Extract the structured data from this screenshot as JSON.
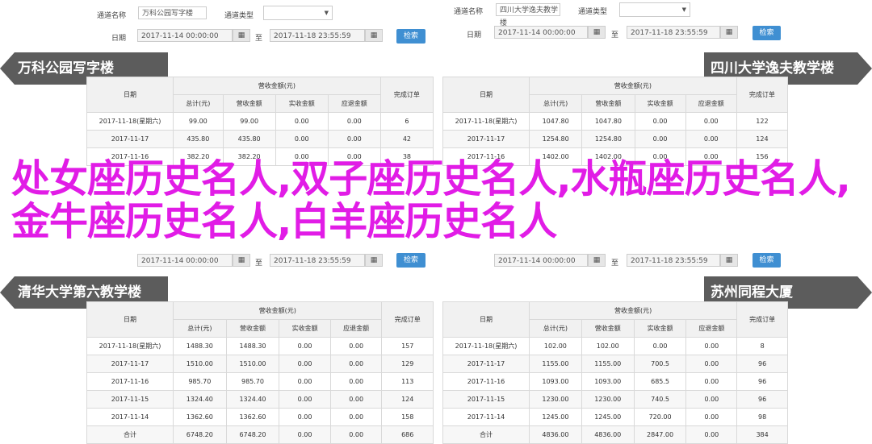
{
  "forms": [
    {
      "id": "tl",
      "school_label": "通道名称",
      "school_value": "万科公园写字楼",
      "type_label": "通道类型",
      "type_value": "",
      "date_label": "日期",
      "date_from": "2017-11-14 00:00:00",
      "sep": "至",
      "date_to": "2017-11-18 23:55:59",
      "query": "检索"
    },
    {
      "id": "tr",
      "school_label": "通道名称",
      "school_value": "四川大学逸夫教学楼",
      "type_label": "通道类型",
      "type_value": "",
      "date_label": "日期",
      "date_from": "2017-11-14 00:00:00",
      "sep": "至",
      "date_to": "2017-11-18 23:55:59",
      "query": "检索"
    },
    {
      "id": "ml",
      "date_from": "2017-11-14 00:00:00",
      "sep": "至",
      "date_to": "2017-11-18 23:55:59",
      "query": "检索"
    },
    {
      "id": "mr",
      "date_from": "2017-11-14 00:00:00",
      "sep": "至",
      "date_to": "2017-11-18 23:55:59",
      "query": "检索"
    }
  ],
  "banners": {
    "tl": "万科公园写字楼",
    "tr": "四川大学逸夫教学楼",
    "bl": "清华大学第六教学楼",
    "br": "苏州同程大厦"
  },
  "table_headers": {
    "date": "日期",
    "revenue": "营收金额(元)",
    "total": "总计(元)",
    "cash_receipt": "营收金额",
    "actual_received": "实收金额",
    "refund": "应退金额",
    "orders": "完成订单"
  },
  "tables": {
    "tl": [
      [
        "2017-11-18(星期六)",
        "99.00",
        "99.00",
        "0.00",
        "0.00",
        "6"
      ],
      [
        "2017-11-17",
        "435.80",
        "435.80",
        "0.00",
        "0.00",
        "42"
      ],
      [
        "2017-11-16",
        "382.20",
        "382.20",
        "0.00",
        "0.00",
        "38"
      ]
    ],
    "tr": [
      [
        "2017-11-18(星期六)",
        "1047.80",
        "1047.80",
        "0.00",
        "0.00",
        "122"
      ],
      [
        "2017-11-17",
        "1254.80",
        "1254.80",
        "0.00",
        "0.00",
        "124"
      ],
      [
        "2017-11-16",
        "1402.00",
        "1402.00",
        "0.00",
        "0.00",
        "156"
      ]
    ],
    "bl": [
      [
        "2017-11-18(星期六)",
        "1488.30",
        "1488.30",
        "0.00",
        "0.00",
        "157"
      ],
      [
        "2017-11-17",
        "1510.00",
        "1510.00",
        "0.00",
        "0.00",
        "129"
      ],
      [
        "2017-11-16",
        "985.70",
        "985.70",
        "0.00",
        "0.00",
        "113"
      ],
      [
        "2017-11-15",
        "1324.40",
        "1324.40",
        "0.00",
        "0.00",
        "124"
      ],
      [
        "2017-11-14",
        "1362.60",
        "1362.60",
        "0.00",
        "0.00",
        "158"
      ],
      [
        "合计",
        "6748.20",
        "6748.20",
        "0.00",
        "0.00",
        "686"
      ]
    ],
    "br": [
      [
        "2017-11-18(星期六)",
        "102.00",
        "102.00",
        "0.00",
        "0.00",
        "8"
      ],
      [
        "2017-11-17",
        "1155.00",
        "1155.00",
        "700.5",
        "0.00",
        "96"
      ],
      [
        "2017-11-16",
        "1093.00",
        "1093.00",
        "685.5",
        "0.00",
        "96"
      ],
      [
        "2017-11-15",
        "1230.00",
        "1230.00",
        "740.5",
        "0.00",
        "96"
      ],
      [
        "2017-11-14",
        "1245.00",
        "1245.00",
        "720.00",
        "0.00",
        "98"
      ],
      [
        "合计",
        "4836.00",
        "4836.00",
        "2847.00",
        "0.00",
        "384"
      ]
    ]
  },
  "overlay_title": "处女座历史名人,双子座历史名人,水瓶座历史名人,金牛座历史名人,白羊座历史名人"
}
